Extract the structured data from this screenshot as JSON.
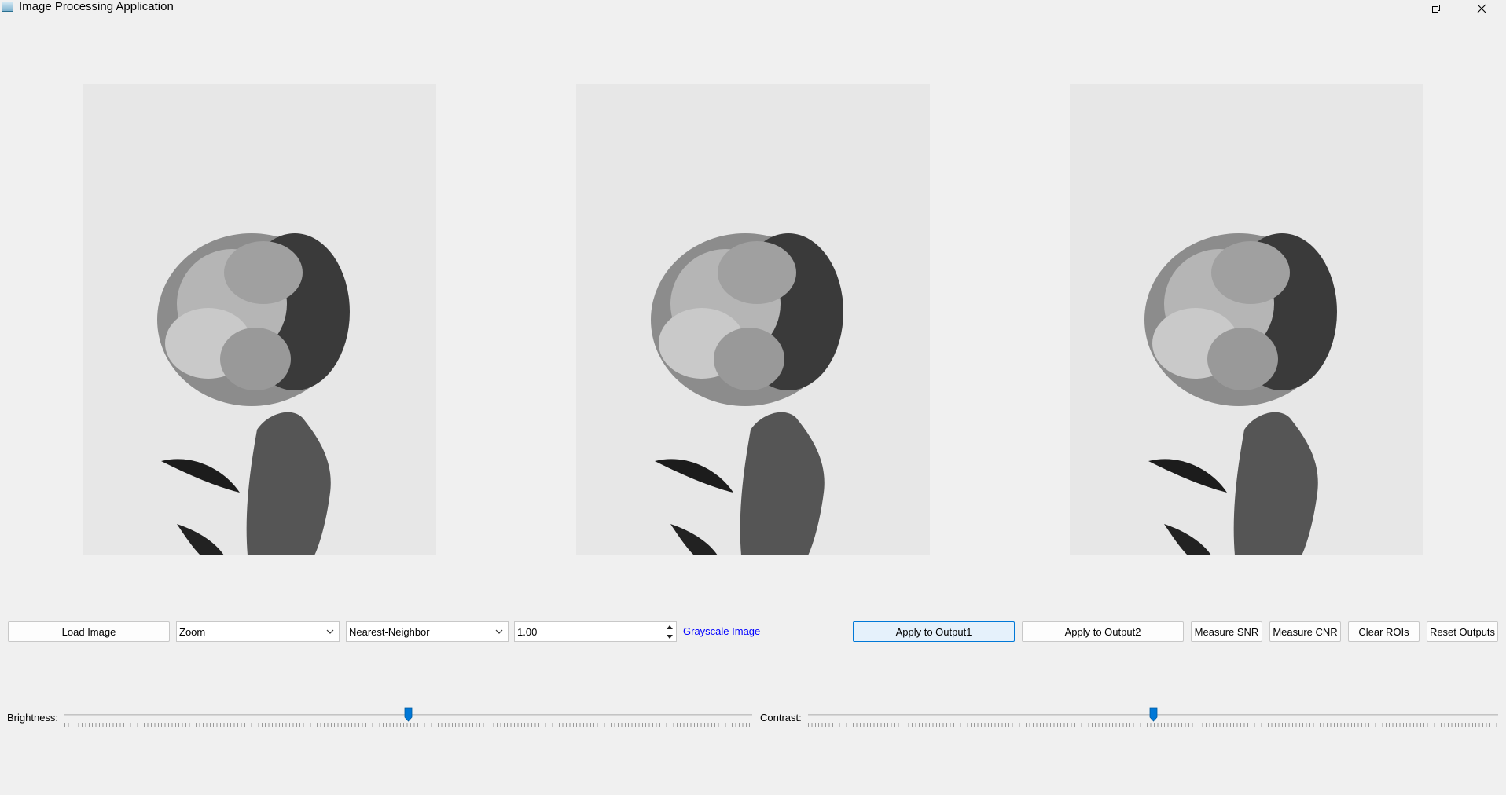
{
  "window": {
    "title": "Image Processing Application",
    "icon": "app-icon",
    "controls": [
      "minimize-icon",
      "restore-icon",
      "close-icon"
    ]
  },
  "panels": [
    {
      "name": "input-image",
      "content": "black-and-white photo of a hand holding a peony flower"
    },
    {
      "name": "output-1",
      "content": "black-and-white photo of a hand holding a peony flower"
    },
    {
      "name": "output-2",
      "content": "black-and-white photo of a hand holding a peony flower"
    }
  ],
  "toolbar": {
    "load_label": "Load Image",
    "operation_value": "Zoom",
    "method_value": "Nearest-Neighbor",
    "factor_value": "1.00",
    "info_text": "Grayscale Image",
    "apply1_label": "Apply to Output1",
    "apply2_label": "Apply to Output2",
    "snr_label": "Measure SNR",
    "cnr_label": "Measure CNR",
    "clear_label": "Clear ROIs",
    "reset_label": "Reset Outputs"
  },
  "sliders": {
    "brightness_label": "Brightness:",
    "brightness_position": 0.5,
    "contrast_label": "Contrast:",
    "contrast_position": 0.5
  },
  "colors": {
    "accent": "#0078d7",
    "info_text": "#0000ff",
    "background": "#f0f0f0"
  }
}
